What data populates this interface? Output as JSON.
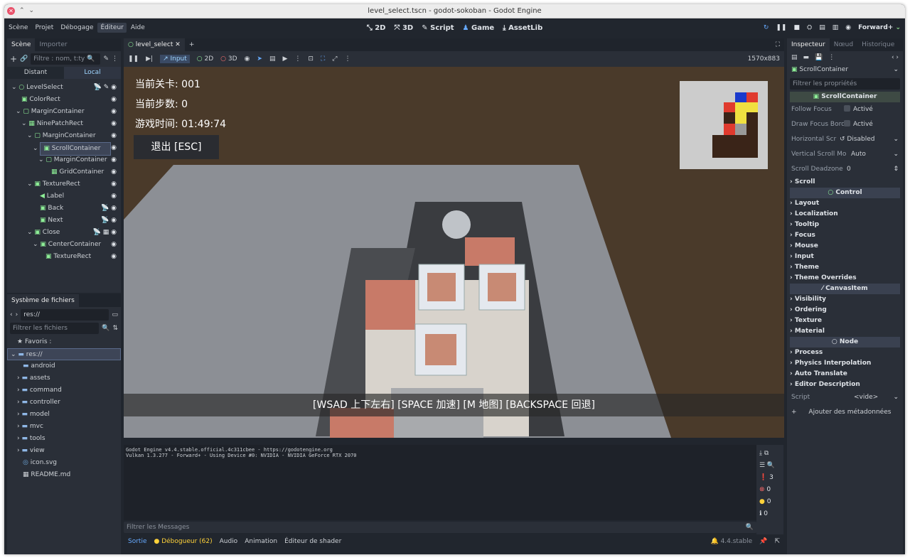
{
  "window": {
    "title": "level_select.tscn - godot-sokoban - Godot Engine"
  },
  "menu": [
    "Scène",
    "Projet",
    "Débogage",
    "Éditeur",
    "Aide"
  ],
  "workspaces": {
    "w2d": "2D",
    "w3d": "3D",
    "script": "Script",
    "game": "Game",
    "assetlib": "AssetLib"
  },
  "renderer": "Forward+",
  "scene_panel": {
    "tabs": [
      "Scène",
      "Importer"
    ],
    "filter_placeholder": "Filtre : nom, t:ty",
    "toggle": [
      "Distant",
      "Local"
    ],
    "nodes": [
      {
        "label": "LevelSelect",
        "indent": 0
      },
      {
        "label": "ColorRect",
        "indent": 1
      },
      {
        "label": "MarginContainer",
        "indent": 1
      },
      {
        "label": "NinePatchRect",
        "indent": 2
      },
      {
        "label": "MarginContainer",
        "indent": 3
      },
      {
        "label": "ScrollContainer",
        "indent": 4
      },
      {
        "label": "MarginContainer",
        "indent": 5
      },
      {
        "label": "GridContainer",
        "indent": 6
      },
      {
        "label": "TextureRect",
        "indent": 3
      },
      {
        "label": "Label",
        "indent": 4
      },
      {
        "label": "Back",
        "indent": 4
      },
      {
        "label": "Next",
        "indent": 4
      },
      {
        "label": "Close",
        "indent": 3
      },
      {
        "label": "CenterContainer",
        "indent": 4
      },
      {
        "label": "TextureRect",
        "indent": 5
      }
    ]
  },
  "fs_panel": {
    "tab": "Système de fichiers",
    "path": "res://",
    "filter_placeholder": "Filtrer les fichiers",
    "favorites": "Favoris :",
    "items": [
      "res://",
      "android",
      "assets",
      "command",
      "controller",
      "model",
      "mvc",
      "tools",
      "view",
      "icon.svg",
      "README.md"
    ]
  },
  "editor_tab": {
    "label": "level_select"
  },
  "toolbar": {
    "input": "Input",
    "t2d": "2D",
    "t3d": "3D",
    "resolution": "1570x883"
  },
  "game": {
    "level": "当前关卡: 001",
    "steps": "当前步数: 0",
    "time": "游戏时间: 01:49:74",
    "exit": "退出 [ESC]",
    "hint": "[WSAD 上下左右]  [SPACE 加速] [M 地图]  [BACKSPACE 回退]"
  },
  "console": {
    "lines": [
      "Godot Engine v4.4.stable.official.4c311cbee - https://godotengine.org",
      "Vulkan 1.3.277 - Forward+ - Using Device #0: NVIDIA - NVIDIA GeForce RTX 2070"
    ],
    "filter_placeholder": "Filtrer les Messages",
    "counts": [
      "3",
      "0",
      "0",
      "0"
    ]
  },
  "bottom_tabs": [
    "Sortie",
    "Débogueur (62)",
    "Audio",
    "Animation",
    "Éditeur de shader"
  ],
  "version": "4.4.stable",
  "inspector": {
    "tabs": [
      "Inspecteur",
      "Nœud",
      "Historique"
    ],
    "node": "ScrollContainer",
    "filter_placeholder": "Filtrer les propriétés",
    "class1": "ScrollContainer",
    "props": [
      {
        "label": "Follow Focus",
        "value": "Activé"
      },
      {
        "label": "Draw Focus Bord",
        "value": "Activé"
      },
      {
        "label": "Horizontal Scr",
        "value": "Disabled"
      },
      {
        "label": "Vertical Scroll Mo",
        "value": "Auto"
      },
      {
        "label": "Scroll Deadzone",
        "value": "0"
      }
    ],
    "scroll": "Scroll",
    "class2": "Control",
    "control_secs": [
      "Layout",
      "Localization",
      "Tooltip",
      "Focus",
      "Mouse",
      "Input",
      "Theme",
      "Theme Overrides"
    ],
    "class3": "CanvasItem",
    "canvas_secs": [
      "Visibility",
      "Ordering",
      "Texture",
      "Material"
    ],
    "class4": "Node",
    "node_secs": [
      "Process",
      "Physics Interpolation",
      "Auto Translate",
      "Editor Description"
    ],
    "script_label": "Script",
    "script_value": "<vide>",
    "add_meta": "Ajouter des métadonnées"
  }
}
